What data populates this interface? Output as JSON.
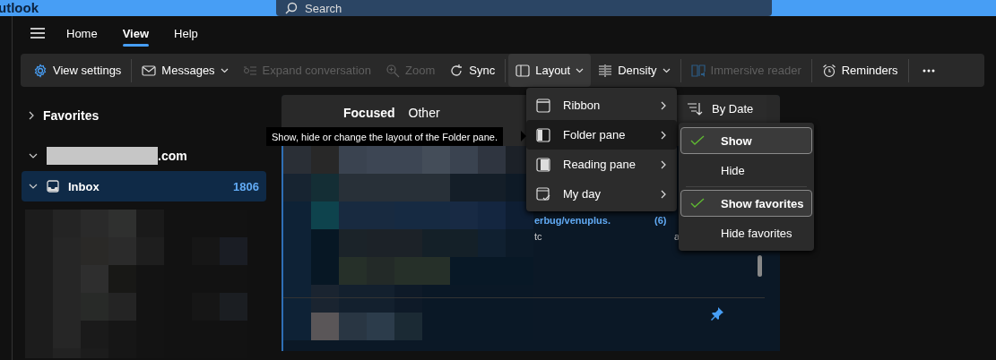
{
  "title_bar": {
    "app_title": "utlook",
    "search": {
      "placeholder": "Search"
    }
  },
  "tabs": [
    {
      "label": "Home",
      "selected": false
    },
    {
      "label": "View",
      "selected": true
    },
    {
      "label": "Help",
      "selected": false
    }
  ],
  "toolbar": [
    {
      "kind": "button",
      "label": "View settings",
      "disabled": false
    },
    {
      "kind": "separator"
    },
    {
      "kind": "button",
      "label": "Messages",
      "disabled": false,
      "dropdown": true
    },
    {
      "kind": "button",
      "label": "Expand conversation",
      "disabled": true
    },
    {
      "kind": "button",
      "label": "Zoom",
      "disabled": true
    },
    {
      "kind": "button",
      "label": "Sync",
      "disabled": false
    },
    {
      "kind": "separator"
    },
    {
      "kind": "button",
      "label": "Layout",
      "disabled": false,
      "dropdown": true,
      "active": true
    },
    {
      "kind": "button",
      "label": "Density",
      "disabled": false,
      "dropdown": true
    },
    {
      "kind": "separator"
    },
    {
      "kind": "button",
      "label": "Immersive reader",
      "disabled": true
    },
    {
      "kind": "separator"
    },
    {
      "kind": "button",
      "label": "Reminders",
      "disabled": false
    },
    {
      "kind": "separator"
    },
    {
      "kind": "more"
    }
  ],
  "folder_pane": {
    "favorites": {
      "label": "Favorites",
      "expanded": false
    },
    "account": {
      "label": ".com",
      "expanded": true
    },
    "folders": [
      {
        "label": "Inbox",
        "count": "1806",
        "expanded": true,
        "selected": true
      }
    ]
  },
  "message_list": {
    "tabs": [
      {
        "label": "Focused",
        "selected": true
      },
      {
        "label": "Other",
        "selected": false
      }
    ],
    "sort": {
      "label": "By Date"
    },
    "fragments": [
      {
        "sender": "erbug/venuplus.",
        "count": "(6)",
        "preview": "tc",
        "tail": "a"
      }
    ]
  },
  "tooltip": {
    "text": "Show, hide or change the layout of the Folder pane."
  },
  "layout_menu": {
    "items": [
      {
        "label": "Ribbon",
        "selected": false
      },
      {
        "label": "Folder pane",
        "selected": true
      },
      {
        "label": "Reading pane",
        "selected": false
      },
      {
        "label": "My day",
        "selected": false
      }
    ]
  },
  "folder_pane_submenu": {
    "groups": [
      [
        {
          "label": "Show",
          "checked": true
        },
        {
          "label": "Hide",
          "checked": false
        }
      ],
      [
        {
          "label": "Show favorites",
          "checked": true
        },
        {
          "label": "Hide favorites",
          "checked": false
        }
      ]
    ]
  }
}
